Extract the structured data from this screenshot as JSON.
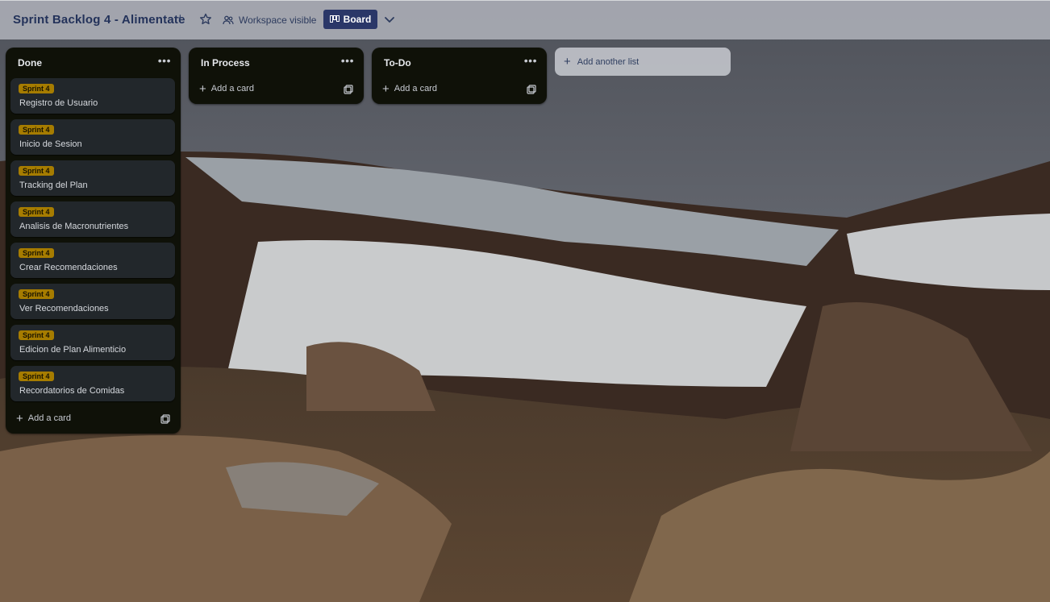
{
  "header": {
    "board_title": "Sprint Backlog 4 - Alimentate",
    "title_action": "+",
    "workspace_visibility": "Workspace visible",
    "view_label": "Board",
    "star_icon": "star-icon",
    "visibility_icon": "people-icon",
    "view_icon": "board-icon",
    "view_switcher_icon": "chevron-down-icon"
  },
  "lists": [
    {
      "title": "Done",
      "menu": "•••",
      "cards": [
        {
          "label": "Sprint 4",
          "title": "Registro de Usuario"
        },
        {
          "label": "Sprint 4",
          "title": "Inicio de Sesion"
        },
        {
          "label": "Sprint 4",
          "title": "Tracking del Plan"
        },
        {
          "label": "Sprint 4",
          "title": "Analisis de Macronutrientes"
        },
        {
          "label": "Sprint 4",
          "title": "Crear Recomendaciones"
        },
        {
          "label": "Sprint 4",
          "title": "Ver Recomendaciones"
        },
        {
          "label": "Sprint 4",
          "title": "Edicion de Plan Alimenticio"
        },
        {
          "label": "Sprint 4",
          "title": "Recordatorios de Comidas"
        }
      ],
      "add_card": "Add a card"
    },
    {
      "title": "In Process",
      "menu": "•••",
      "cards": [],
      "add_card": "Add a card"
    },
    {
      "title": "To-Do",
      "menu": "•••",
      "cards": [],
      "add_card": "Add a card"
    }
  ],
  "add_list": "Add another list",
  "colors": {
    "list_bg": "#0f1108",
    "card_bg": "#22272b",
    "label_sprint": "#a67c00",
    "header_bg": "#b0b2ba",
    "board_button": "#2a3768"
  }
}
